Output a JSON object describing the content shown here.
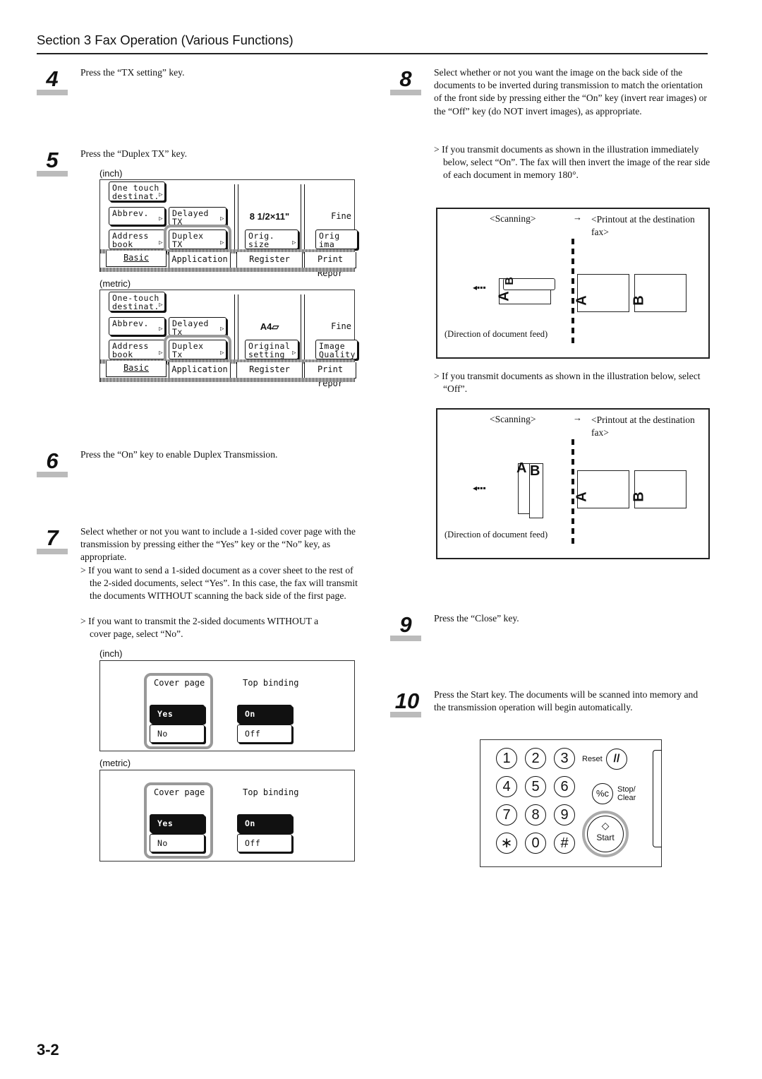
{
  "header": {
    "title": "Section 3  Fax Operation (Various Functions)"
  },
  "page_number": "3-2",
  "steps": {
    "s4": {
      "num": "4",
      "text": "Press the “TX setting” key."
    },
    "s5": {
      "num": "5",
      "text": "Press the “Duplex TX” key."
    },
    "s6": {
      "num": "6",
      "text": "Press the “On” key to enable Duplex Transmission."
    },
    "s7": {
      "num": "7",
      "text": "Select whether or not you want to include a 1-sided cover page with the transmission by pressing either the “Yes” key or the “No” key, as appropriate.",
      "sub1": "> If you want to send a 1-sided document as a cover sheet to the rest of the 2-sided documents, select “Yes”. In this case, the fax will transmit the documents WITHOUT scanning the back side of the first page.",
      "sub2": "> If you want to transmit the 2-sided documents WITHOUT a cover page, select “No”."
    },
    "s8": {
      "num": "8",
      "text": "Select whether or not you want the image on the back side of the documents to be inverted during transmission to match the orientation of the front side by pressing either the “On” key (invert rear images) or the “Off” key (do NOT invert images), as appropriate.",
      "sub1": "> If you transmit documents as shown in the illustration immediately below, select “On”. The fax will then invert the image of the rear side of each document in memory 180°.",
      "sub2": "> If you transmit documents as shown in the illustration below, select “Off”."
    },
    "s9": {
      "num": "9",
      "text": "Press the “Close” key."
    },
    "s10": {
      "num": "10",
      "text": "Press the Start key. The documents will be scanned into memory and the transmission operation will begin automatically."
    }
  },
  "panels": {
    "inch": {
      "label": "(inch)",
      "one_touch": "One touch\ndestinat.",
      "abbrev": "Abbrev.",
      "delayed": "Delayed TX",
      "address": "Address\nbook",
      "duplex": "Duplex\nTX",
      "size": "8 1/2×11\"",
      "quality": "Fine",
      "orig_size": "Orig. size\nsetting",
      "orig_quality": "Orig ima\nquality",
      "tabs": [
        "Basic",
        "Application",
        "Register",
        "Print Repor"
      ]
    },
    "metric": {
      "label": "(metric)",
      "one_touch": "One-touch\ndestinat.",
      "abbrev": "Abbrev.",
      "delayed": "Delayed Tx",
      "address": "Address\nbook",
      "duplex": "Duplex\nTx",
      "size": "A4▱",
      "quality": "Fine",
      "orig_size": "Original\nsetting",
      "orig_quality": "Image\nQuality",
      "tabs": [
        "Basic",
        "Application",
        "Register",
        "Print repor"
      ]
    }
  },
  "cover_panels": {
    "inch": {
      "label": "(inch)",
      "cover_page": "Cover page",
      "top_binding": "Top binding",
      "yes": "Yes",
      "no": "No",
      "on": "On",
      "off": "Off"
    },
    "metric": {
      "label": "(metric)",
      "cover_page": "Cover page",
      "top_binding": "Top binding",
      "yes": "Yes",
      "no": "No",
      "on": "On",
      "off": "Off"
    }
  },
  "diagrams": {
    "on": {
      "scanning": "<Scanning>",
      "arrow": "→",
      "printout": "<Printout at the destination fax>",
      "feed": "(Direction of document feed)",
      "a": "A",
      "b": "B"
    },
    "off": {
      "scanning": "<Scanning>",
      "arrow": "→",
      "printout": "<Printout at the destination fax>",
      "feed": "(Direction of document feed)",
      "a": "A",
      "b": "B"
    }
  },
  "keypad": {
    "keys": [
      "1",
      "2",
      "3",
      "4",
      "5",
      "6",
      "7",
      "8",
      "9",
      "∗",
      "0",
      "#"
    ],
    "reset": "Reset",
    "stop_clear": "Stop/\nClear",
    "start": "Start",
    "reset_icon": "//",
    "stop_icon": "%c",
    "start_icon": "◇"
  }
}
